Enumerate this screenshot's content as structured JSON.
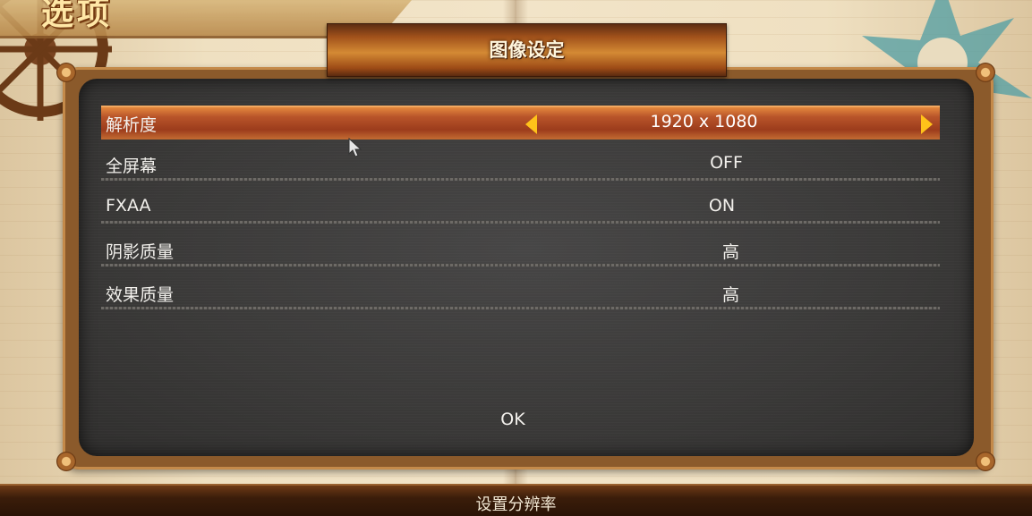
{
  "screen": {
    "options_title": "选项",
    "header_title": "图像设定"
  },
  "settings": [
    {
      "label": "解析度",
      "value": "1920 x 1080"
    },
    {
      "label": "全屏幕",
      "value": "OFF"
    },
    {
      "label": "FXAA",
      "value": "ON"
    },
    {
      "label": "阴影质量",
      "value": "高"
    },
    {
      "label": "效果质量",
      "value": "高"
    }
  ],
  "ok_label": "OK",
  "status_text": "设置分辨率",
  "icons": {
    "left_arrow": "arrow-left-icon",
    "right_arrow": "arrow-right-icon",
    "cursor": "mouse-cursor-icon"
  },
  "colors": {
    "accent": "#ffc21a",
    "selected_row": "#b8542a",
    "panel": "#3a3938",
    "text": "#f2f0ec"
  }
}
